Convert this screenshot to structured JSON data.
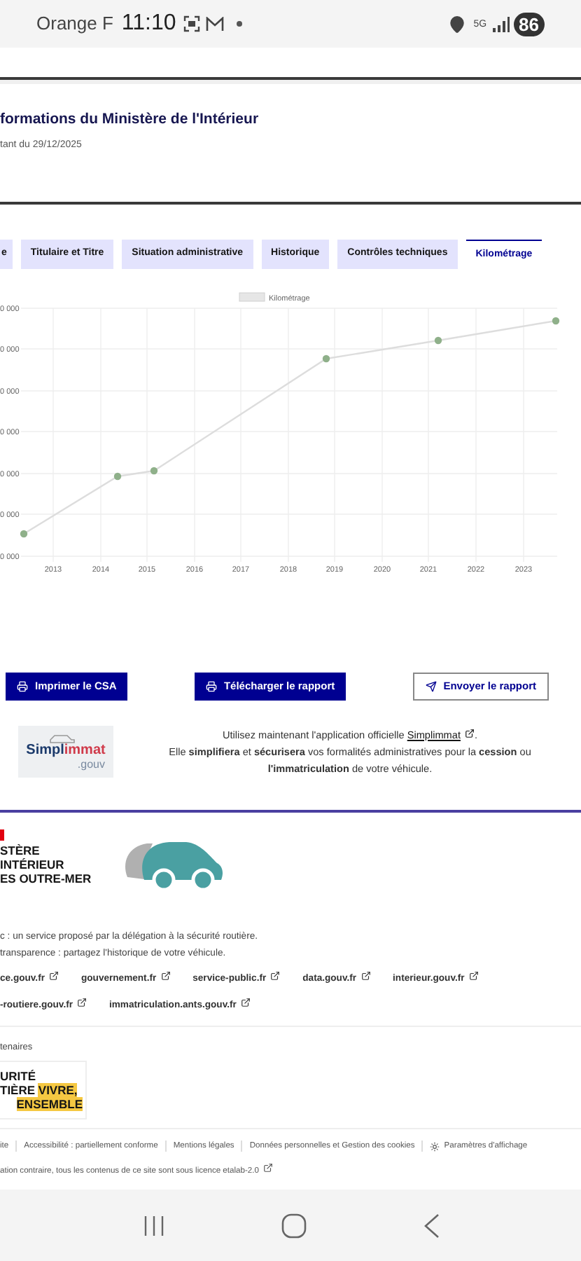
{
  "status_bar": {
    "carrier": "Orange F",
    "time": "11:10",
    "network": "5G",
    "battery": "86"
  },
  "header": {
    "title": "formations du Ministère de l'Intérieur",
    "subtitle": "tant du 29/12/2025"
  },
  "tabs": [
    {
      "label": "e",
      "selected": false
    },
    {
      "label": "Titulaire et Titre",
      "selected": false
    },
    {
      "label": "Situation administrative",
      "selected": false
    },
    {
      "label": "Historique",
      "selected": false
    },
    {
      "label": "Contrôles techniques",
      "selected": false
    },
    {
      "label": "Kilométrage",
      "selected": true
    }
  ],
  "chart": {
    "legend": "Kilométrage",
    "y_tick_labels": [
      "0 000",
      "0 000",
      "0 000",
      "0 000",
      "0 000",
      "0 000",
      "0 000"
    ],
    "x_tick_labels": [
      "2013",
      "2014",
      "2015",
      "2016",
      "2017",
      "2018",
      "2019",
      "2020",
      "2021",
      "2022",
      "2023"
    ]
  },
  "actions": [
    {
      "label": "Imprimer le CSA",
      "kind": "primary"
    },
    {
      "label": "Télécharger le rapport",
      "kind": "primary"
    },
    {
      "label": "Envoyer le rapport",
      "kind": "secondary"
    }
  ],
  "promo": {
    "logo_lines": [
      "Simpl",
      "immat",
      ".gouv"
    ],
    "intro": "Utilisez maintenant l'application officielle",
    "link": "Simplimmat",
    "after": ".",
    "body": "Elle **simplifiera** et **sécurisera** vos formalités administratives pour la **cession** ou **l'immatriculation** de votre véhicule."
  },
  "footer": {
    "ministry_lines": [
      "STÈRE",
      "INTÉRIEUR",
      "ES OUTRE-MER"
    ],
    "description": [
      "c : un service proposé par la délégation à la sécurité routière.",
      "transparence : partagez l'historique de votre véhicule."
    ],
    "links": [
      [
        "ce.gouv.fr",
        "gouvernement.fr",
        "service-public.fr",
        "data.gouv.fr",
        "interieur.gouv.fr"
      ],
      [
        "-routiere.gouv.fr",
        "immatriculation.ants.gouv.fr"
      ]
    ],
    "partners_label": "tenaires",
    "partner_logo": {
      "line1": "URITÉ",
      "line2": "TIÈRE",
      "highlight1": "VIVRE,",
      "highlight2": "ENSEMBLE"
    },
    "bottom_links": [
      "ite",
      "Accessibilité : partiellement conforme",
      "Mentions légales",
      "Données personnelles et Gestion des cookies",
      "Paramètres d'affichage"
    ],
    "licence": "ation contraire, tous les contenus de ce site sont sous licence etalab-2.0"
  }
}
